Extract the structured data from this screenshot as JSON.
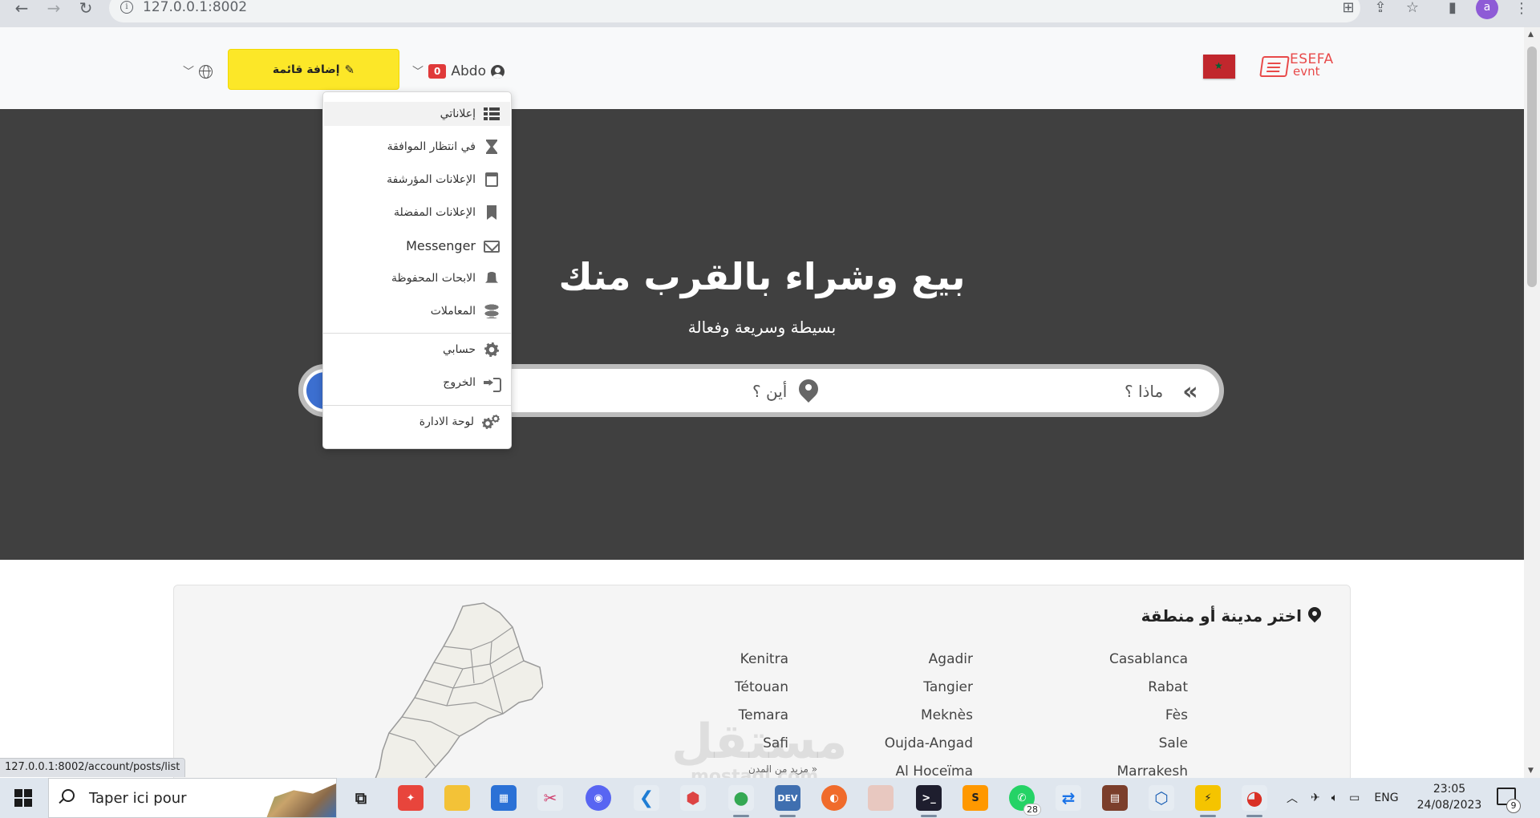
{
  "browser": {
    "url": "127.0.0.1:8002",
    "profile_initial": "a"
  },
  "header": {
    "brand_line1": "ESEFA",
    "brand_line2": "evnt",
    "username": "Abdo",
    "notification_count": "0",
    "add_listing_label": "إضافة قائمة"
  },
  "dropdown": {
    "items": [
      {
        "label": "إعلاناتي",
        "icon": "list-icon"
      },
      {
        "label": "في انتظار الموافقة",
        "icon": "hourglass-icon"
      },
      {
        "label": "الإعلانات المؤرشفة",
        "icon": "calendar-x-icon"
      },
      {
        "label": "الإعلانات المفضلة",
        "icon": "bookmark-icon"
      },
      {
        "label": "Messenger",
        "icon": "envelope-icon"
      },
      {
        "label": "الابحات المحفوظة",
        "icon": "bell-icon"
      },
      {
        "label": "المعاملات",
        "icon": "coins-icon"
      },
      {
        "label": "حسابي",
        "icon": "gear-icon"
      },
      {
        "label": "الخروج",
        "icon": "sign-out-icon"
      },
      {
        "label": "لوحة الادارة",
        "icon": "gears-icon"
      }
    ]
  },
  "hero": {
    "title": "بيع وشراء بالقرب منك",
    "subtitle": "بسيطة وسريعة وفعالة",
    "what_placeholder": "ماذا ؟",
    "where_placeholder": "أين ؟"
  },
  "cities": {
    "title": "اختر مدينة أو منطقة",
    "col1": [
      "Casablanca",
      "Rabat",
      "Fès",
      "Sale",
      "Marrakesh"
    ],
    "col2": [
      "Agadir",
      "Tangier",
      "Meknès",
      "Oujda-Angad",
      "Al Hoceïma"
    ],
    "col3": [
      "Kenitra",
      "Tétouan",
      "Temara",
      "Safi"
    ],
    "more": "مزيد من المدن »"
  },
  "watermark": {
    "line1": "مستقل",
    "line2": "mostaql.com"
  },
  "status_url": "127.0.0.1:8002/account/posts/list",
  "taskbar": {
    "search_text": "Taper ici pour",
    "language": "ENG",
    "time": "23:05",
    "date": "24/08/2023",
    "whatsapp_count": "28",
    "notification_count": "9"
  },
  "colors": {
    "accent_yellow": "#fce728",
    "hero_bg": "#404040",
    "badge_red": "#e03a3a",
    "brand_red": "#e84a4a"
  }
}
